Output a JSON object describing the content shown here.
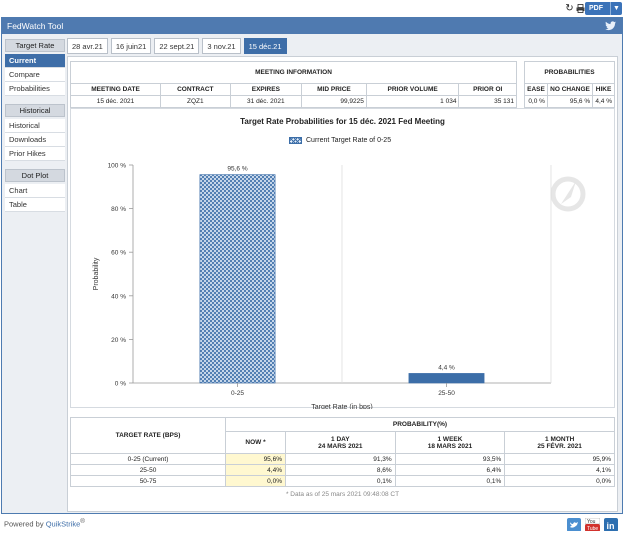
{
  "topbar": {
    "refresh_icon": "refresh-icon",
    "print_icon": "print-icon",
    "pdf_label": "PDF"
  },
  "app": {
    "title": "FedWatch Tool"
  },
  "sidebar": {
    "groups": [
      {
        "label": "Target Rate",
        "items": [
          "Current",
          "Compare",
          "Probabilities"
        ]
      },
      {
        "label": "Historical",
        "items": [
          "Historical",
          "Downloads",
          "Prior Hikes"
        ]
      },
      {
        "label": "Dot Plot",
        "items": [
          "Chart",
          "Table"
        ]
      }
    ],
    "active": "Current"
  },
  "tabs": [
    "28 avr.21",
    "16 juin21",
    "22 sept.21",
    "3 nov.21",
    "15 déc.21"
  ],
  "active_tab": "15 déc.21",
  "meeting_info": {
    "header": "MEETING INFORMATION",
    "columns": [
      "MEETING DATE",
      "CONTRACT",
      "EXPIRES",
      "MID PRICE",
      "PRIOR VOLUME",
      "PRIOR OI"
    ],
    "row": [
      "15 déc. 2021",
      "ZQZ1",
      "31 déc. 2021",
      "99,9225",
      "1 034",
      "35 131"
    ]
  },
  "probabilities": {
    "header": "PROBABILITIES",
    "columns": [
      "EASE",
      "NO CHANGE",
      "HIKE"
    ],
    "row": [
      "0,0 %",
      "95,6 %",
      "4,4 %"
    ]
  },
  "chart_data": {
    "type": "bar",
    "title": "Target Rate Probabilities for 15 déc. 2021 Fed Meeting",
    "legend": "Current Target Rate of 0-25",
    "legend_position": "top-center",
    "xlabel": "Target Rate (in bps)",
    "ylabel": "Probability",
    "categories": [
      "0-25",
      "25-50"
    ],
    "values": [
      95.6,
      4.4
    ],
    "value_labels": [
      "95,6 %",
      "4,4 %"
    ],
    "ylim": [
      0,
      100
    ],
    "yticks": [
      0,
      20,
      40,
      60,
      80,
      100
    ],
    "ytick_labels": [
      "0 %",
      "20 %",
      "40 %",
      "60 %",
      "80 %",
      "100 %"
    ],
    "grid": "vertical",
    "colors": {
      "current": "#3c6ea8",
      "other": "#3c6ea8"
    }
  },
  "prob_table": {
    "left_header": "TARGET RATE (BPS)",
    "group_header": "PROBABILITY(%)",
    "col_top": [
      "NOW *",
      "1 DAY",
      "1 WEEK",
      "1 MONTH"
    ],
    "col_bottom": [
      "",
      "24 MARS 2021",
      "18 MARS 2021",
      "25 FÉVR. 2021"
    ],
    "rows": [
      {
        "rate": "0-25 (Current)",
        "values": [
          "95,6%",
          "91,3%",
          "93,5%",
          "95,9%"
        ]
      },
      {
        "rate": "25-50",
        "values": [
          "4,4%",
          "8,6%",
          "6,4%",
          "4,1%"
        ]
      },
      {
        "rate": "50-75",
        "values": [
          "0,0%",
          "0,1%",
          "0,1%",
          "0,0%"
        ]
      }
    ],
    "footnote": "* Data as of 25 mars 2021 09:48:08 CT"
  },
  "footer": {
    "powered_by": "Powered by",
    "brand": "QuikStrike",
    "reg": "®",
    "icons": [
      "twitter-icon",
      "youtube-icon",
      "linkedin-icon"
    ]
  }
}
